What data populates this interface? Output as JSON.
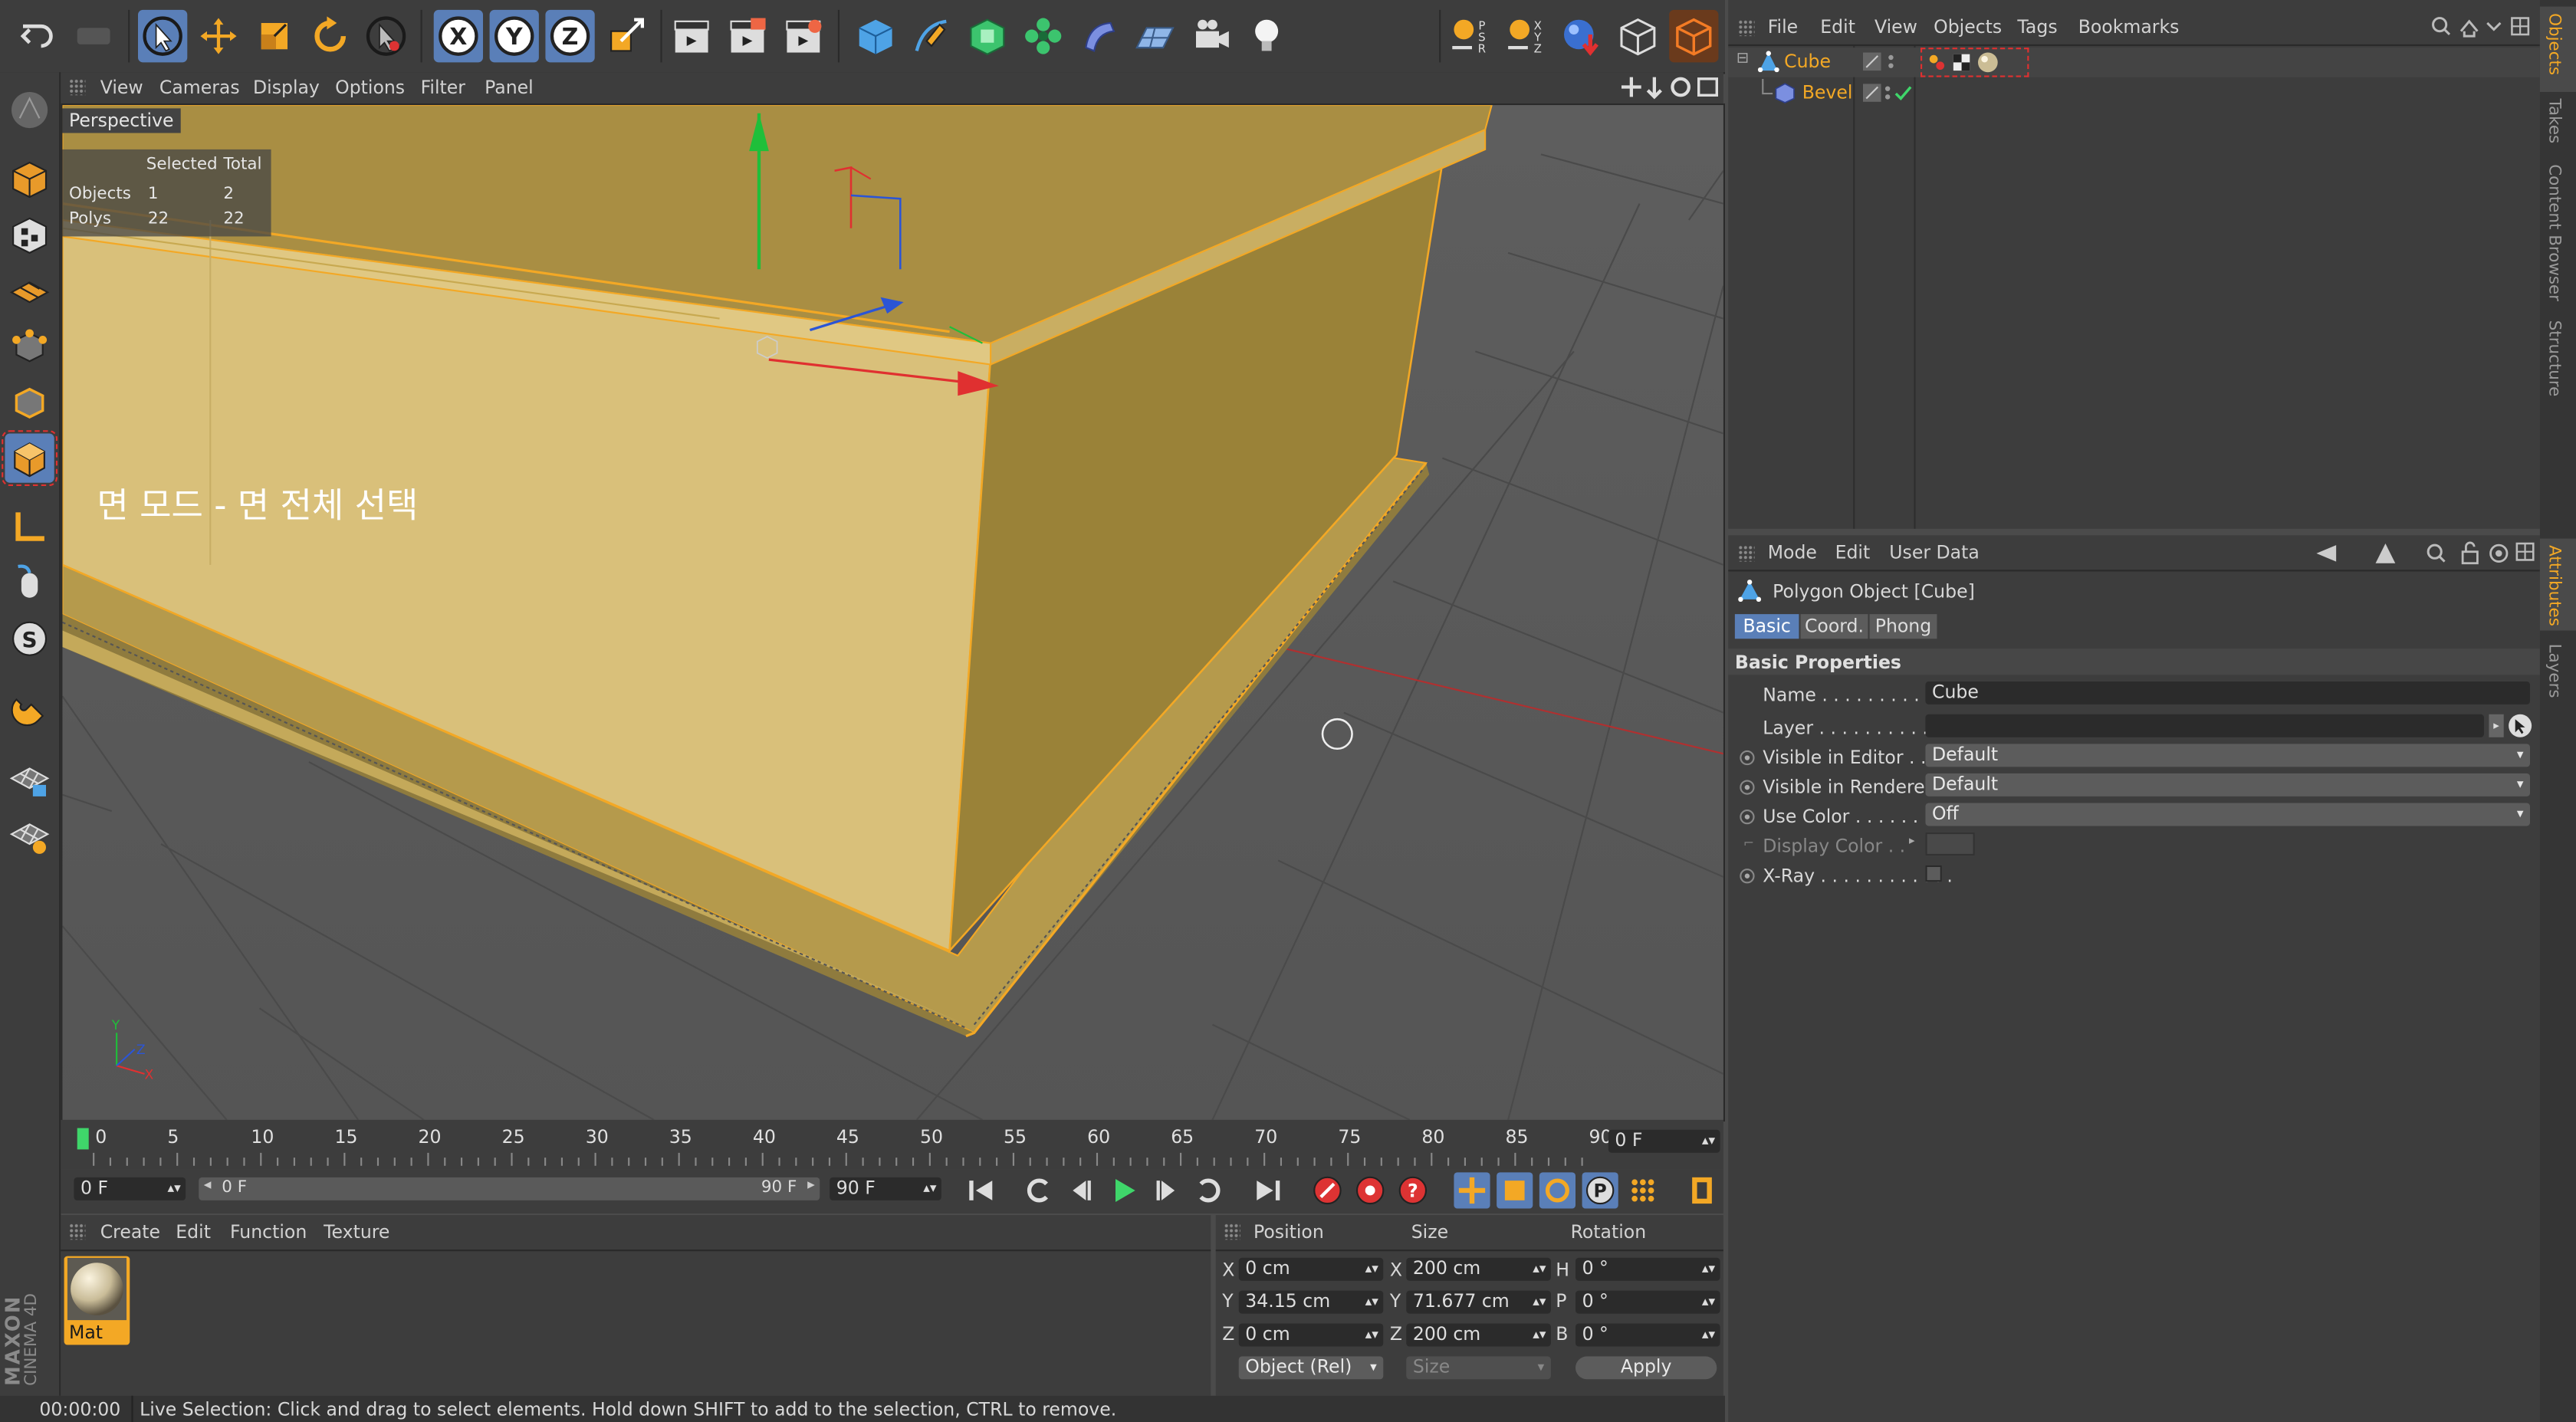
{
  "colors": {
    "accent": "#f3a825",
    "selection_blue": "#5a7fb8",
    "highlight_red": "#e03030",
    "panel": "#3d3d3d"
  },
  "viewport": {
    "menu": [
      "View",
      "Cameras",
      "Display",
      "Options",
      "Filter",
      "Panel"
    ],
    "label": "Perspective",
    "hud": {
      "headers": [
        "Selected",
        "Total"
      ],
      "rows": [
        {
          "name": "Objects",
          "selected": "1",
          "total": "2"
        },
        {
          "name": "Polys",
          "selected": "22",
          "total": "22"
        }
      ]
    },
    "annotation": "면 모드 - 면 전체 선택"
  },
  "timeline": {
    "ticks": [
      "0",
      "5",
      "10",
      "15",
      "20",
      "25",
      "30",
      "35",
      "40",
      "45",
      "50",
      "55",
      "60",
      "65",
      "70",
      "75",
      "80",
      "85",
      "90"
    ],
    "current_frame": "0 F"
  },
  "transport": {
    "start": "0 F",
    "range_start": "0 F",
    "range_end": "90 F",
    "end": "90 F"
  },
  "material_manager": {
    "menu": [
      "Create",
      "Edit",
      "Function",
      "Texture"
    ],
    "materials": [
      {
        "name": "Mat"
      }
    ]
  },
  "coordinates": {
    "headers": [
      "Position",
      "Size",
      "Rotation"
    ],
    "rows": [
      {
        "axis": "X",
        "position": "0 cm",
        "size_axis": "X",
        "size": "200 cm",
        "rot_axis": "H",
        "rotation": "0 °"
      },
      {
        "axis": "Y",
        "position": "34.15 cm",
        "size_axis": "Y",
        "size": "71.677 cm",
        "rot_axis": "P",
        "rotation": "0 °"
      },
      {
        "axis": "Z",
        "position": "0 cm",
        "size_axis": "Z",
        "size": "200 cm",
        "rot_axis": "B",
        "rotation": "0 °"
      }
    ],
    "mode": "Object (Rel)",
    "size_mode": "Size",
    "apply": "Apply"
  },
  "status": {
    "time": "00:00:00",
    "message": "Live Selection: Click and drag to select elements. Hold down SHIFT to add to the selection, CTRL to remove."
  },
  "brand": {
    "vendor": "MAXON",
    "product": "CINEMA 4D"
  },
  "object_manager": {
    "menu": [
      "File",
      "Edit",
      "View",
      "Objects",
      "Tags",
      "Bookmarks"
    ],
    "objects": [
      {
        "name": "Cube"
      },
      {
        "name": "Bevel"
      }
    ]
  },
  "attributes": {
    "menu": [
      "Mode",
      "Edit",
      "User Data"
    ],
    "title": "Polygon Object [Cube]",
    "tabs": [
      "Basic",
      "Coord.",
      "Phong"
    ],
    "section": "Basic Properties",
    "props": [
      {
        "label": "Name . . . . . . . . . . . .",
        "value": "Cube"
      },
      {
        "label": "Layer . . . . . . . . . . . .",
        "value": ""
      },
      {
        "label": "Visible in Editor . . .",
        "value": "Default"
      },
      {
        "label": "Visible in Renderer",
        "value": "Default"
      },
      {
        "label": "Use Color . . . . . . . .",
        "value": "Off"
      },
      {
        "label": "Display Color . .",
        "value": ""
      },
      {
        "label": "X-Ray . . . . . . . . . . . .",
        "value": ""
      }
    ]
  },
  "side_tabs": [
    "Objects",
    "Takes",
    "Content Browser",
    "Structure",
    "Attributes",
    "Layers"
  ]
}
